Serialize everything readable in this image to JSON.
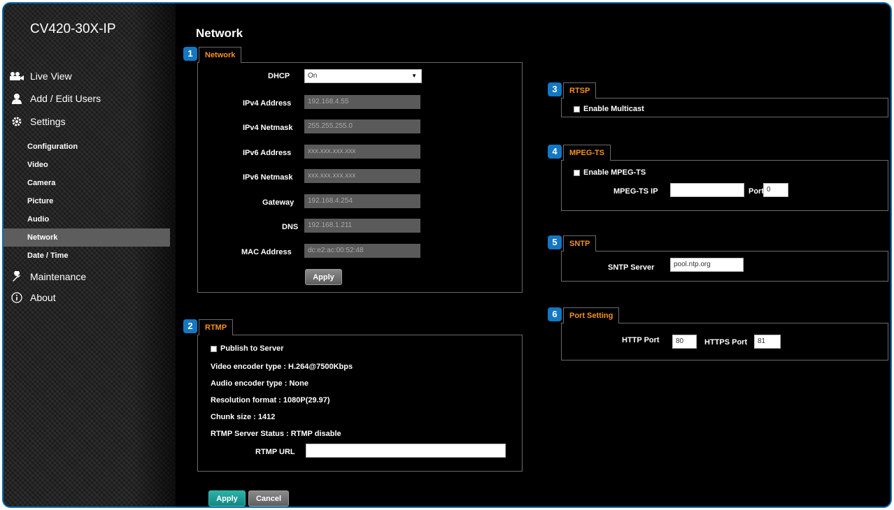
{
  "device_name": "CV420-30X-IP",
  "sidebar": {
    "main": [
      {
        "label": "Live View",
        "icon": "camera-people-icon"
      },
      {
        "label": "Add / Edit Users",
        "icon": "user-icon"
      },
      {
        "label": "Settings",
        "icon": "gear-icon"
      },
      {
        "label": "Maintenance",
        "icon": "wrench-icon"
      },
      {
        "label": "About",
        "icon": "info-icon"
      }
    ],
    "sub": [
      "Configuration",
      "Video",
      "Camera",
      "Picture",
      "Audio",
      "Network",
      "Date / Time"
    ],
    "active_sub": "Network"
  },
  "page_title": "Network",
  "network": {
    "badge": "1",
    "tab": "Network",
    "dhcp_label": "DHCP",
    "dhcp_value": "On",
    "fields": [
      {
        "label": "IPv4 Address",
        "value": "192.168.4.55"
      },
      {
        "label": "IPv4 Netmask",
        "value": "255.255.255.0"
      },
      {
        "label": "IPv6 Address",
        "value": "xxx.xxx.xxx.xxx"
      },
      {
        "label": "IPv6 Netmask",
        "value": "xxx.xxx.xxx.xxx"
      },
      {
        "label": "Gateway",
        "value": "192.168.4.254"
      },
      {
        "label": "DNS",
        "value": "192.168.1.211"
      },
      {
        "label": "MAC Address",
        "value": "dc:e2:ac:00:52:48"
      }
    ],
    "apply": "Apply"
  },
  "rtmp": {
    "badge": "2",
    "tab": "RTMP",
    "publish_label": "Publish to Server",
    "video_encoder": "Video encoder type : H.264@7500Kbps",
    "audio_encoder": "Audio encoder type : None",
    "resolution": "Resolution format : 1080P(29.97)",
    "chunk": "Chunk size : 1412",
    "status": "RTMP Server Status : RTMP disable",
    "url_label": "RTMP URL",
    "url_value": ""
  },
  "rtsp": {
    "badge": "3",
    "tab": "RTSP",
    "multicast_label": "Enable Multicast"
  },
  "mpegts": {
    "badge": "4",
    "tab": "MPEG-TS",
    "enable_label": "Enable MPEG-TS",
    "ip_label": "MPEG-TS IP",
    "ip_value": "",
    "port_label": "Port",
    "port_value": "0"
  },
  "sntp": {
    "badge": "5",
    "tab": "SNTP",
    "server_label": "SNTP Server",
    "server_value": "pool.ntp.org"
  },
  "port_setting": {
    "badge": "6",
    "tab": "Port Setting",
    "http_label": "HTTP Port",
    "http_value": "80",
    "https_label": "HTTPS Port",
    "https_value": "81"
  },
  "footer": {
    "apply": "Apply",
    "cancel": "Cancel"
  }
}
